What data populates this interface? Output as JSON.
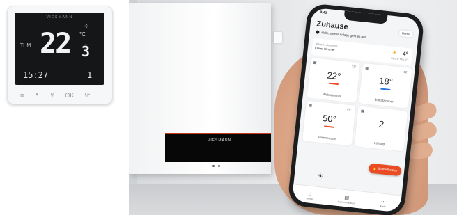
{
  "thermostat": {
    "brand": "VIESMANN",
    "temperature": "22",
    "decimal": "3",
    "unit": "°C",
    "time": "15:27",
    "day": "1",
    "keys": [
      "≡",
      "∧",
      "∨",
      "OK",
      "⟳",
      "↓"
    ]
  },
  "boiler": {
    "logo": "VIESMANN"
  },
  "app": {
    "status_time": "9:41",
    "title": "Zuhause",
    "home_button": "Home",
    "status_message": "Hallo, deiner Anlage geht es gut.",
    "weather": {
      "line1": "Aktuell in Innenort",
      "line2": "Klarer Himmel",
      "temp": "4°",
      "sub": "Max. 8° Min. 2°"
    },
    "cards": [
      {
        "target": "21°",
        "value": "22°",
        "name": "Wohnzimmer",
        "bar_color": "#ea4b22"
      },
      {
        "target": "16°",
        "value": "18°",
        "name": "Schlafzimmer",
        "bar_color": "#2a79d8"
      },
      {
        "target": "45°",
        "value": "50°",
        "name": "Warmwasser",
        "bar_color": "#ea4b22"
      },
      {
        "target": "",
        "value": "2",
        "name": "Lüftung",
        "bar_color": "#ffffff"
      }
    ],
    "boost_button": "Schnellheizen",
    "tabs": [
      "Home",
      "Kommunikation",
      "Mehr"
    ]
  }
}
